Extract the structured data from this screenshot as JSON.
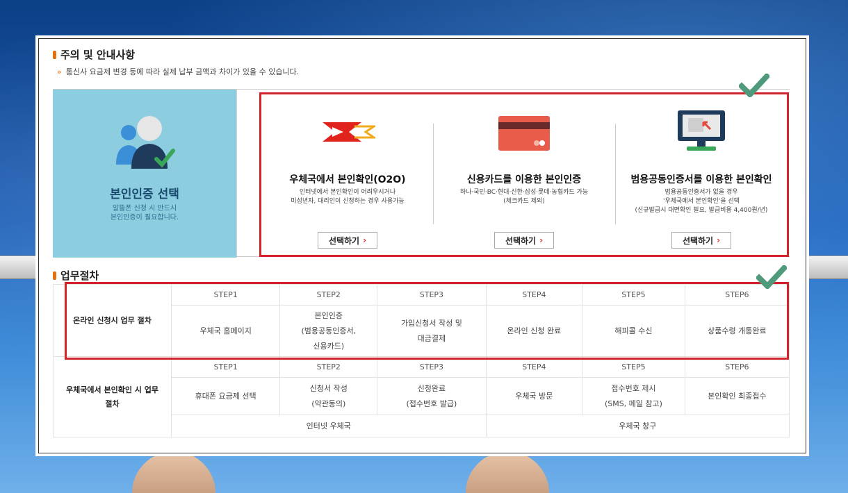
{
  "notice_section": {
    "title": "주의 및 안내사항",
    "notice": "통신사 요금제 변경 등에 따라 실제 납부 금액과 차이가 있을 수 있습니다."
  },
  "auth_select": {
    "title": "본인인증 선택",
    "subtitle_line1": "알뜰폰 신청 시 반드시",
    "subtitle_line2": "본인인증이 필요합니다."
  },
  "options": [
    {
      "title": "우체국에서 본인확인(O2O)",
      "desc1": "인터넷에서 본인확인이 어려우시거나",
      "desc2": "미성년자, 대리인이 신청하는 경우 사용가능",
      "desc3": "",
      "button": "선택하기"
    },
    {
      "title": "신용카드를 이용한 본인인증",
      "desc1": "하나·국민·BC·현대·신한·삼성·롯데·농협카드 가능",
      "desc2": "(체크카드 제외)",
      "desc3": "",
      "button": "선택하기"
    },
    {
      "title": "범용공동인증서를 이용한 본인확인",
      "desc1": "범용공동인증서가 없을 경우",
      "desc2": "'우체국에서 본인확인'을 선택",
      "desc3": "(신규발급시 대면확인 필요, 발급비용 4,400원/년)",
      "button": "선택하기"
    }
  ],
  "process_section": {
    "title": "업무절차",
    "online": {
      "label": "온라인 신청시 업무 절차",
      "steps": [
        "STEP1",
        "STEP2",
        "STEP3",
        "STEP4",
        "STEP5",
        "STEP6"
      ],
      "cells": [
        {
          "l1": "우체국 홈페이지",
          "l2": "",
          "l3": ""
        },
        {
          "l1": "본인인증",
          "l2": "(범용공동인증서,",
          "l3": "신용카드)"
        },
        {
          "l1": "가입신청서 작성 및",
          "l2": "대금결제",
          "l3": ""
        },
        {
          "l1": "온라인 신청 완료",
          "l2": "",
          "l3": ""
        },
        {
          "l1": "해피콜 수신",
          "l2": "",
          "l3": ""
        },
        {
          "l1": "상품수령 개통완료",
          "l2": "",
          "l3": ""
        }
      ]
    },
    "postoffice": {
      "label_line1": "우체국에서 본인확인 시 업무",
      "label_line2": "절차",
      "steps": [
        "STEP1",
        "STEP2",
        "STEP3",
        "STEP4",
        "STEP5",
        "STEP6"
      ],
      "cells": [
        {
          "l1": "휴대폰 요금제 선택",
          "l2": ""
        },
        {
          "l1": "신청서 작성",
          "l2": "(약관동의)"
        },
        {
          "l1": "신청완료",
          "l2": "(접수번호 발급)"
        },
        {
          "l1": "우체국 방문",
          "l2": ""
        },
        {
          "l1": "접수번호 제시",
          "l2": "(SMS, 메일 참고)"
        },
        {
          "l1": "본인확인 최종접수",
          "l2": ""
        }
      ],
      "footer_left": "인터넷 우체국",
      "footer_right": "우체국 창구"
    }
  },
  "colors": {
    "accent_red": "#d4212a",
    "bullet_orange": "#e4700e",
    "check_green": "#4f9a7a",
    "card_blue": "#8ccde0"
  }
}
